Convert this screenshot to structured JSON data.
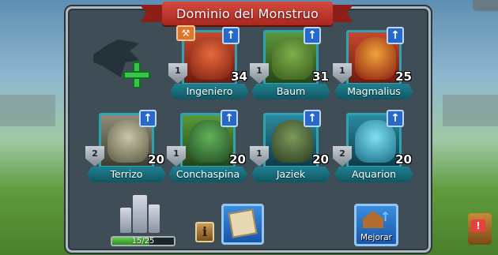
{
  "title": "Dominio del Monstruo",
  "icons": {
    "upgrade_arrow": "↑",
    "info": "i",
    "training": "dumbbell-icon",
    "alert": "!"
  },
  "monsters": [
    {
      "name": "Ingeniero",
      "level": "1",
      "count": "34",
      "color": "#c9472e"
    },
    {
      "name": "Baum",
      "level": "1",
      "count": "31",
      "color": "#5a9a3a"
    },
    {
      "name": "Magmalius",
      "level": "1",
      "count": "25",
      "color": "#c9472e"
    },
    {
      "name": "Terrizo",
      "level": "2",
      "count": "20",
      "color": "#8e8c78"
    },
    {
      "name": "Conchaspina",
      "level": "1",
      "count": "20",
      "color": "#5a9a3a"
    },
    {
      "name": "Jaziek",
      "level": "1",
      "count": "20",
      "color": "#2a8aa0"
    },
    {
      "name": "Aquarion",
      "level": "2",
      "count": "20",
      "color": "#2a8aa0"
    }
  ],
  "capacity": {
    "text": "15/25",
    "current": 15,
    "max": 25
  },
  "buttons": {
    "upgrade_label": "Mejorar"
  },
  "colors": {
    "ribbon": "#c0392b",
    "nameplate": "#1a7382",
    "progress": "#4cbf3a",
    "button": "#2a77d0"
  }
}
